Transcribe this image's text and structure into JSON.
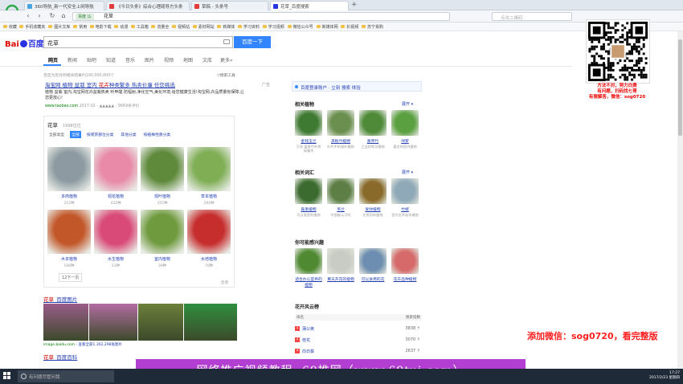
{
  "browser": {
    "tabs": [
      {
        "label": "360导航_新一代安全上网导航",
        "color": "#4aa3e0"
      },
      {
        "label": "《今日头条》综合心理疏导方头条",
        "color": "#e23b3b"
      },
      {
        "label": "草稿 - 头条号",
        "color": "#e23b3b"
      },
      {
        "label": "花草_百度搜索",
        "color": "#2932e1",
        "active": true
      }
    ],
    "address": {
      "secure_label": "百度 认",
      "url": "花草"
    },
    "search_placeholder": "点击二维码",
    "bookmarks": [
      "收藏",
      "手机收藏夹",
      "图片文库",
      "常用",
      "电影下载",
      "动漫",
      "工具箱",
      "流量全",
      "视频站",
      "素材网站",
      "新媒体",
      "学习资料",
      "学习视频",
      "微信公众号",
      "新媒体网",
      "扒视频",
      "苏宁易购"
    ]
  },
  "baidu": {
    "logo_bai": "Bai",
    "logo_du": "百度",
    "query": "花草",
    "search_button": "百度一下",
    "tabs": [
      "网页",
      "新闻",
      "贴吧",
      "知道",
      "音乐",
      "图片",
      "视频",
      "地图",
      "文库",
      "更多»"
    ],
    "result_count": "百度为您找到相关结果约100,000,000个",
    "search_tools": "▽搜索工具"
  },
  "ad": {
    "title_pre": "淘宝网 植物 盆栽 室内 ",
    "title_hl": "花卉",
    "title_post": "种类繁多 热卖价廉 任您挑选",
    "badge": "广告",
    "desc": "植物 盆栽 室内,淘宝网花卉盆栽热卖 听甲醛 防辐射,净化空气,美化环境,给您健康生活!淘宝网,卉品质量有保障,让您更放心!",
    "url": "www.taobao.com",
    "date": "2017-02",
    "rating": "- ▲▲▲▲▲ - 9669条评价"
  },
  "plant_card": {
    "title": "花草",
    "subtitle": "1998位位",
    "filters": [
      {
        "label": "全部类型"
      },
      {
        "label": "全部",
        "on": true
      },
      {
        "label": "按观赏部位分类",
        "link": true
      },
      {
        "label": "其他分类",
        "link": true
      },
      {
        "label": "按植株性质分类",
        "link": true
      }
    ],
    "items": [
      {
        "name": "多肉植物",
        "count": "215种",
        "color": "#8d9aa1"
      },
      {
        "name": "观花植物",
        "count": "432种",
        "color": "#e88aa8"
      },
      {
        "name": "观叶植物",
        "count": "355种",
        "color": "#5f8a3c"
      },
      {
        "name": "草本植物",
        "count": "294种",
        "color": "#7fae55"
      },
      {
        "name": "木本植物",
        "count": "108种",
        "color": "#c2572a"
      },
      {
        "name": "水生植物",
        "count": "51种",
        "color": "#d94a78"
      },
      {
        "name": "室内植物",
        "count": "39种",
        "color": "#6f9a3e"
      },
      {
        "name": "水培植物",
        "count": "70种",
        "color": "#c62d2d"
      }
    ],
    "more": "12下一页",
    "feedback": "反馈"
  },
  "image_result": {
    "title_hl": "花草",
    "title_post": "_百度图片",
    "source": "image.baidu.com",
    "more_text": "- 查看全部1,362,298张图片",
    "strip_colors": [
      "#9a5c8a",
      "#b36ca3",
      "#6c7f3a",
      "#2f8f3f"
    ]
  },
  "baike": {
    "title_hl": "花草",
    "title_post": "_百度百科"
  },
  "right_panel": {
    "login_bar": "百度登录账户 · 立刻 搜索 体验",
    "sections": [
      {
        "title": "相关植物",
        "expand": "展开 ▾",
        "items": [
          {
            "name": "金钱玉兰",
            "desc": "又名:富贵竹叶常绿灌木",
            "color": "#3f7a33"
          },
          {
            "name": "黑板竹植物",
            "desc": "叶片中的观叶植物",
            "color": "#6a8f4e"
          },
          {
            "name": "富贵竹",
            "desc": "工业的常见植物",
            "color": "#4e8a38"
          },
          {
            "name": "绿萝",
            "desc": "著名的室内植物",
            "color": "#5aa040"
          }
        ]
      },
      {
        "title": "相关词汇",
        "expand": "展开 ▾",
        "items": [
          {
            "name": "嘉墨植物",
            "desc": "可以观赏的植物",
            "color": "#3b6b2f"
          },
          {
            "name": "吊兰",
            "desc": "中国被认可的",
            "color": "#5d7f45"
          },
          {
            "name": "发财植物",
            "desc": "在常用的植物",
            "color": "#8a6a2a"
          },
          {
            "name": "竹椒",
            "desc": "室内艺术苗木植物",
            "color": "#8fa9b8"
          }
        ]
      },
      {
        "title": "你可能感兴趣",
        "items": [
          {
            "name": "适合办公室养的植物",
            "desc": "",
            "color": "#4f8a33"
          },
          {
            "name": "黄天开花的植物",
            "desc": "",
            "color": "#c9ccc4"
          },
          {
            "name": "可以食用的花",
            "desc": "",
            "color": "#6d8eb0"
          },
          {
            "name": "花卉品种植物",
            "desc": "",
            "color": "#d66a6a"
          }
        ]
      }
    ],
    "hot_title": "花开风云榜",
    "hot_head_left": "排名",
    "hot_head_right": "搜索指数",
    "hot_rows": [
      {
        "rank": "1",
        "kw": "蒲公英",
        "val": "3838 ↑"
      },
      {
        "rank": "2",
        "kw": "桂花",
        "val": "3070 ↑"
      },
      {
        "rank": "3",
        "kw": "向日葵",
        "val": "2637 ↑"
      }
    ]
  },
  "overlay": {
    "promo": [
      "方法不对，努力白费",
      "有问题，扫码找七哥",
      "有偿解答，微信：sog0720"
    ],
    "wechat": "添加微信：sog0720，看完整版",
    "banner": "网络推广视频教程--69推网（www.69tui.com）"
  },
  "taskbar": {
    "search": "有问题尽管问我",
    "time": "17:27",
    "date": "2017/2/23 星期四"
  }
}
